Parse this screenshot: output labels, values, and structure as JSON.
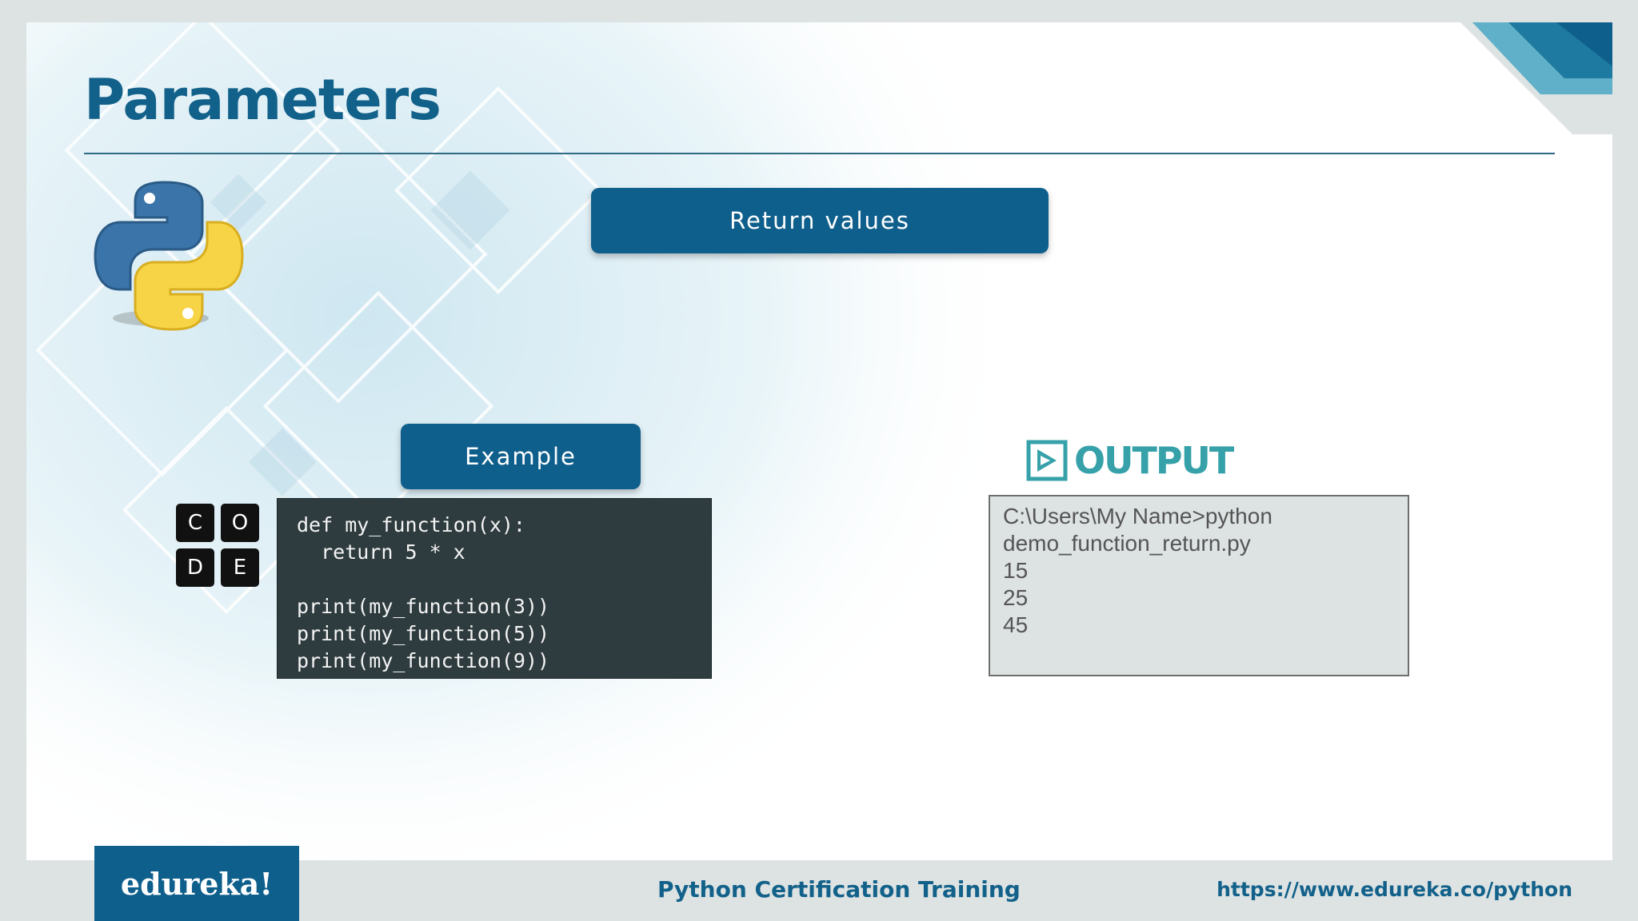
{
  "slide": {
    "title": "Parameters",
    "return_values_label": "Return values",
    "example_label": "Example"
  },
  "code_logo": {
    "letters": [
      "C",
      "O",
      "D",
      "E"
    ]
  },
  "code": "def my_function(x):\n  return 5 * x\n\nprint(my_function(3))\nprint(my_function(5))\nprint(my_function(9))",
  "output": {
    "label": "OUTPUT",
    "text": "C:\\Users\\My Name>python\ndemo_function_return.py\n15\n25\n45"
  },
  "footer": {
    "brand": "edureka!",
    "course": "Python Certification Training",
    "url": "https://www.edureka.co/python"
  },
  "colors": {
    "primary": "#0f5f8c",
    "title": "#12618a",
    "output_accent": "#37a1aa",
    "code_bg": "#2f3c3f"
  }
}
